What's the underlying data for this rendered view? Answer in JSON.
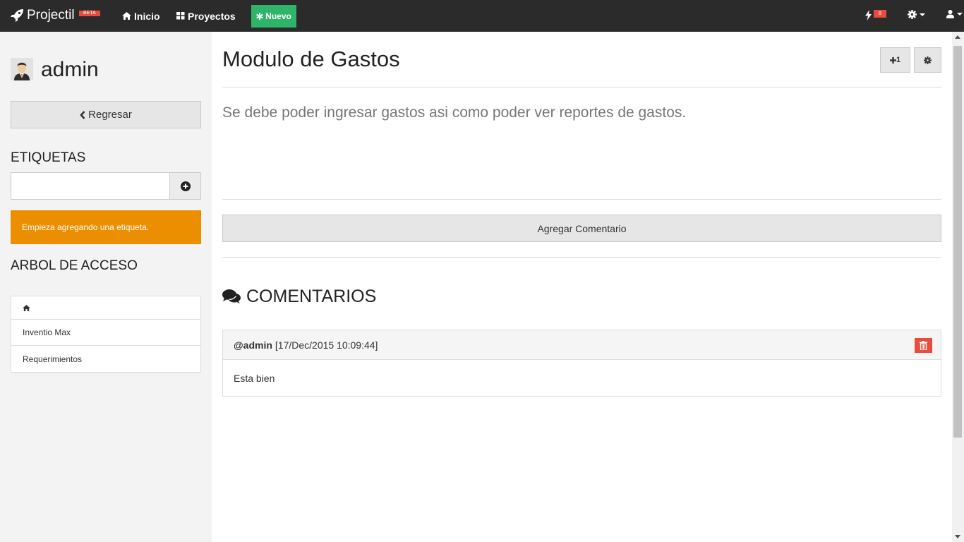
{
  "navbar": {
    "brand": "Projectil",
    "beta_badge": "BETA",
    "links": [
      {
        "label": "Inicio",
        "icon": "home-icon"
      },
      {
        "label": "Proyectos",
        "icon": "grid-icon"
      }
    ],
    "new_button": {
      "label": "Nuevo",
      "icon": "asterisk-icon"
    },
    "notification_count": "8",
    "icons": [
      "rocket-icon",
      "bolt-icon",
      "gear-icon",
      "user-icon"
    ]
  },
  "sidebar": {
    "user_name": "admin",
    "back_button": "Regresar",
    "tags_title": "ETIQUETAS",
    "tag_input_value": "",
    "tags_empty_message": "Empieza agregando una etiqueta.",
    "access_tree_title": "ARBOL DE ACCESO",
    "tree_items": [
      "",
      "Inventio Max",
      "Requerimientos"
    ]
  },
  "main": {
    "title": "Modulo de Gastos",
    "plus_button": "1",
    "description": "Se debe poder ingresar gastos asi como poder ver reportes de gastos.",
    "add_comment_button": "Agregar Comentario",
    "comments_title": "COMENTARIOS",
    "comments": [
      {
        "user": "@admin",
        "date": "[17/Dec/2015 10:09:44]",
        "body": "Esta bien"
      }
    ]
  },
  "colors": {
    "navbar_bg": "#2b2b2b",
    "new_button_bg": "#2fb56a",
    "alert_bg": "#eb8f00",
    "danger": "#e74c3c"
  }
}
